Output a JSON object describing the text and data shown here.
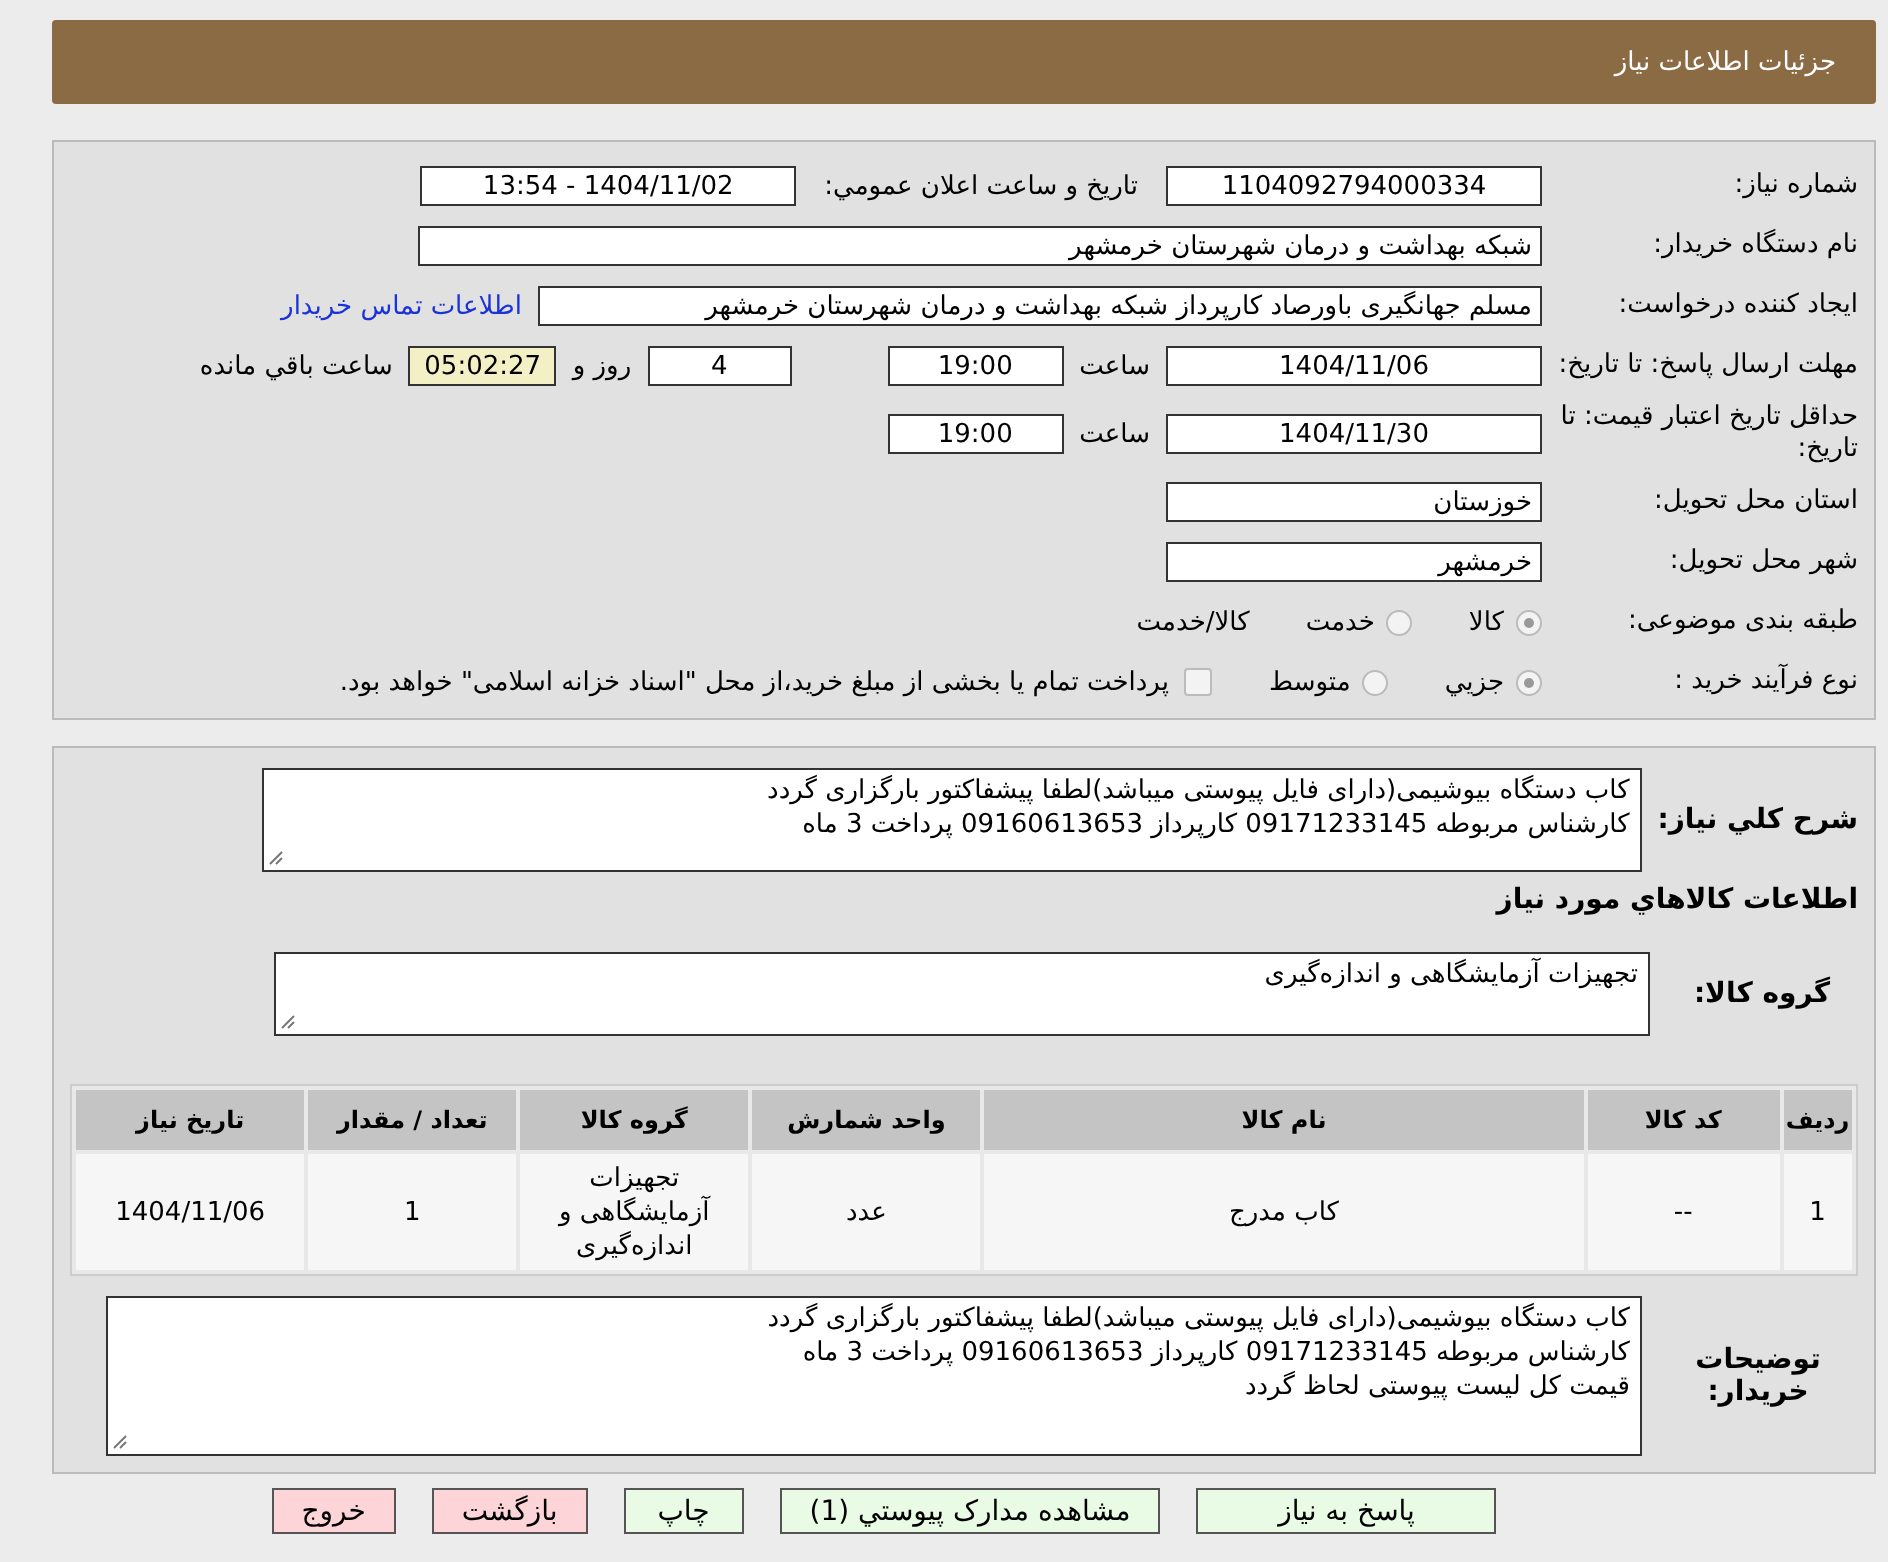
{
  "header": {
    "title": "جزئيات اطلاعات نیاز"
  },
  "need_number": {
    "label": "شماره نیاز:",
    "value": "1104092794000334"
  },
  "announce": {
    "label": "تاریخ و ساعت اعلان عمومي:",
    "value": "1404/11/02 - 13:54"
  },
  "buyer": {
    "label": "نام دستگاه خریدار:",
    "value": "شبکه بهداشت و درمان شهرستان خرمشهر"
  },
  "requester": {
    "label": "ایجاد کننده درخواست:",
    "value": "مسلم جهانگیری باورصاد کارپرداز شبکه بهداشت و درمان شهرستان خرمشهر",
    "link": "اطلاعات تماس خریدار"
  },
  "reply_deadline": {
    "label": "مهلت ارسال پاسخ: تا تاریخ:",
    "date": "1404/11/06",
    "time_label": "ساعت",
    "time": "19:00",
    "days": "4",
    "days_label": "روز و",
    "remaining": "05:02:27",
    "remaining_label": "ساعت باقي مانده"
  },
  "price_validity": {
    "label": "حداقل تاریخ اعتبار قیمت: تا تاریخ:",
    "date": "1404/11/30",
    "time_label": "ساعت",
    "time": "19:00"
  },
  "province": {
    "label": "استان محل تحویل:",
    "value": "خوزستان"
  },
  "city": {
    "label": "شهر محل تحویل:",
    "value": "خرمشهر"
  },
  "category": {
    "label": "طبقه بندی موضوعی:",
    "options": [
      {
        "label": "كالا",
        "selected": true
      },
      {
        "label": "خدمت",
        "selected": false
      }
    ],
    "extra": "كالا/خدمت"
  },
  "purchase_process": {
    "label": "نوع فرآیند خرید :",
    "options": [
      {
        "label": "جزيي",
        "selected": true
      },
      {
        "label": "متوسط",
        "selected": false
      }
    ],
    "payment": {
      "checked": false,
      "text": "پرداخت تمام یا بخشی از مبلغ خرید،از محل \"اسناد خزانه اسلامی\" خواهد بود."
    }
  },
  "description": {
    "label": "شرح كلي نیاز:",
    "lines": [
      "كاب دستگاه بیوشیمی(دارای فایل پیوستی میباشد)لطفا پیشفاکتور بارگزاری گردد",
      "کارشناس مربوطه 09171233145 کارپرداز 09160613653 پرداخت 3 ماه"
    ]
  },
  "items_title": "اطلاعات كالاهاي مورد نیاز",
  "goods_group": {
    "label": "گروه كالا:",
    "value": "تجهیزات آزمایشگاهی و اندازه‌گیری"
  },
  "table": {
    "columns": [
      "رديف",
      "كد كالا",
      "نام كالا",
      "واحد شمارش",
      "گروه كالا",
      "تعداد / مقدار",
      "تاریخ نیاز"
    ],
    "rows": [
      [
        "1",
        "--",
        "کاب مدرج",
        "عدد",
        "تجهیزات آزمایشگاهی و اندازه‌گیری",
        "1",
        "1404/11/06"
      ]
    ]
  },
  "buyer_notes": {
    "label": "توضیحات خریدار:",
    "lines": [
      "کاب دستگاه بیوشیمی(دارای فایل پیوستی میباشد)لطفا پیشفاکتور بارگزاری گردد",
      "کارشناس مربوطه 09171233145 کارپرداز 09160613653 پرداخت 3 ماه",
      "قیمت کل لیست پیوستی لحاظ گردد"
    ]
  },
  "buttons": [
    {
      "label": "پاسخ به نیاز",
      "kind": "action"
    },
    {
      "label": "مشاهده مدارک پیوستي (1)",
      "kind": "action"
    },
    {
      "label": "چاپ",
      "kind": "action"
    },
    {
      "label": "بازگشت",
      "kind": "exit"
    },
    {
      "label": "خروج",
      "kind": "exit"
    }
  ]
}
